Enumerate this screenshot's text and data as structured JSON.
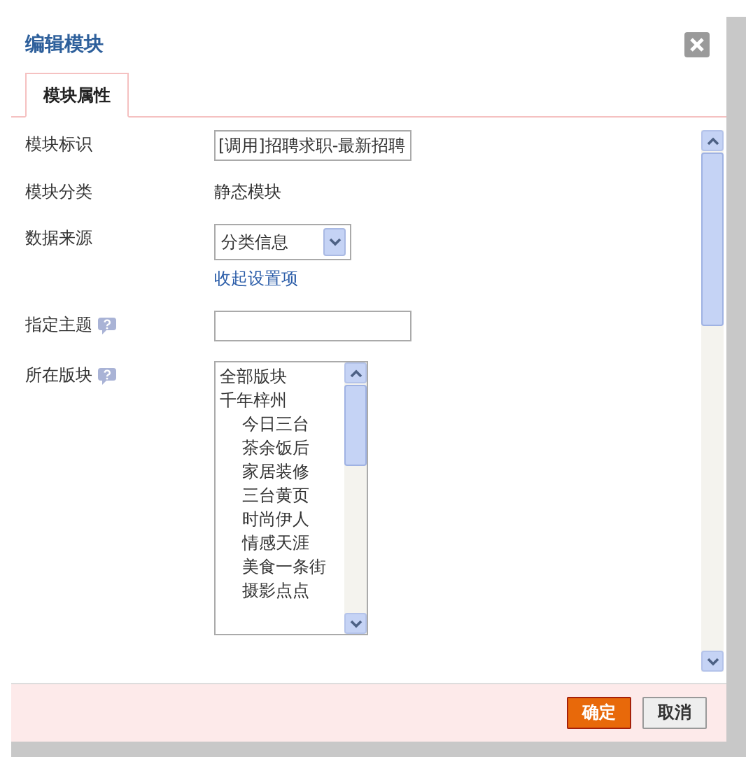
{
  "dialog": {
    "title": "编辑模块"
  },
  "tabs": [
    {
      "label": "模块属性",
      "selected": true
    }
  ],
  "fields": [
    {
      "kind": "text",
      "label": "模块标识",
      "value": "[调用]招聘求职-最新招聘"
    },
    {
      "kind": "static",
      "label": "模块分类",
      "value": "静态模块"
    },
    {
      "kind": "select",
      "label": "数据来源",
      "value": "分类信息",
      "link": "收起设置项"
    },
    {
      "kind": "text",
      "label": "指定主题",
      "help": true
    },
    {
      "kind": "listbox",
      "label": "所在版块",
      "help": true,
      "options": [
        {
          "label": "全部版块"
        },
        {
          "label": "千年梓州",
          "children": [
            {
              "label": "今日三台"
            },
            {
              "label": "茶余饭后"
            },
            {
              "label": "家居装修"
            },
            {
              "label": "三台黄页"
            },
            {
              "label": "时尚伊人"
            },
            {
              "label": "情感天涯"
            },
            {
              "label": "美食一条街"
            },
            {
              "label": "摄影点点"
            }
          ]
        }
      ]
    }
  ],
  "buttons": [
    {
      "label": "确定",
      "kind": "primary"
    },
    {
      "label": "取消",
      "kind": "secondary"
    }
  ]
}
